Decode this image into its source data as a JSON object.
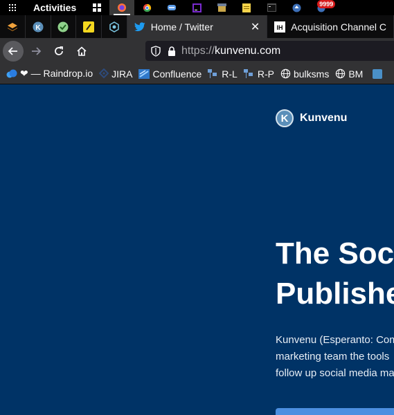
{
  "topbar": {
    "activities_label": "Activities",
    "badge_count": "9999"
  },
  "tabs": {
    "active_tab_label": "Home / Twitter",
    "next_tab_label": "Acquisition Channel C"
  },
  "navbar": {
    "url_scheme": "https://",
    "url_host": "kunvenu.com"
  },
  "bookmarks": [
    {
      "label": "❤ — Raindrop.io"
    },
    {
      "label": "JIRA"
    },
    {
      "label": "Confluence"
    },
    {
      "label": "R-L"
    },
    {
      "label": "R-P"
    },
    {
      "label": "bulksms"
    },
    {
      "label": "BM"
    }
  ],
  "page": {
    "brand_name": "Kunvenu",
    "brand_initial": "K",
    "headline_line1": "The Soci",
    "headline_line2": "Publishe",
    "lede_line1": "Kunvenu (Esperanto: Com",
    "lede_line2": "marketing team the tools",
    "lede_line3": "follow up social media ma"
  },
  "colors": {
    "page_background": "#003366",
    "cta": "#4c8fe0",
    "twitter_blue": "#1d9bf0"
  }
}
